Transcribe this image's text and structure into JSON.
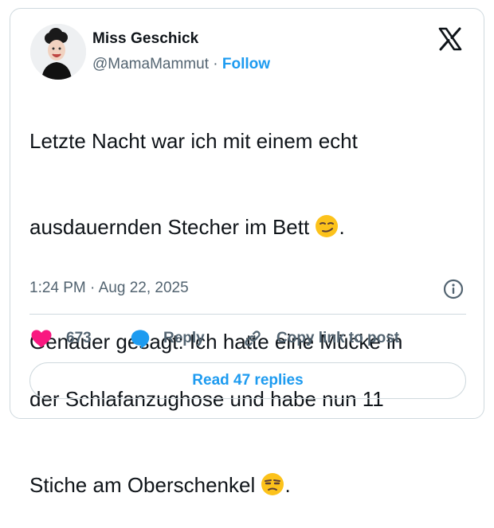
{
  "author": {
    "name": "Miss Geschick",
    "handle": "@MamaMammut",
    "separator": "·",
    "follow_label": "Follow",
    "avatar_icon": "profile-photo"
  },
  "logo_icon": "x-logo",
  "tweet": {
    "line1": "Letzte Nacht war ich mit einem echt",
    "line2": "ausdauernden Stecher im Bett ",
    "emoji1": "smirking-face-emoji",
    "line2_end": ".",
    "line3": "Genauer gesagt: Ich hatte eine Mücke in",
    "line4": "der Schlafanzughose und habe nun 11",
    "line5": "Stiche am Oberschenkel ",
    "emoji2": "unamused-face-emoji",
    "line5_end": "."
  },
  "meta": {
    "time": "1:24 PM",
    "separator": "·",
    "date": "Aug 22, 2025",
    "info_icon": "info-icon"
  },
  "actions": {
    "like_count": "673",
    "reply_label": "Reply",
    "copy_label": "Copy link to post"
  },
  "read_replies_label": "Read 47 replies",
  "colors": {
    "accent": "#1d9bf0",
    "like": "#f91880",
    "text": "#0f1419",
    "secondary": "#536471",
    "border": "#cfd9de"
  }
}
